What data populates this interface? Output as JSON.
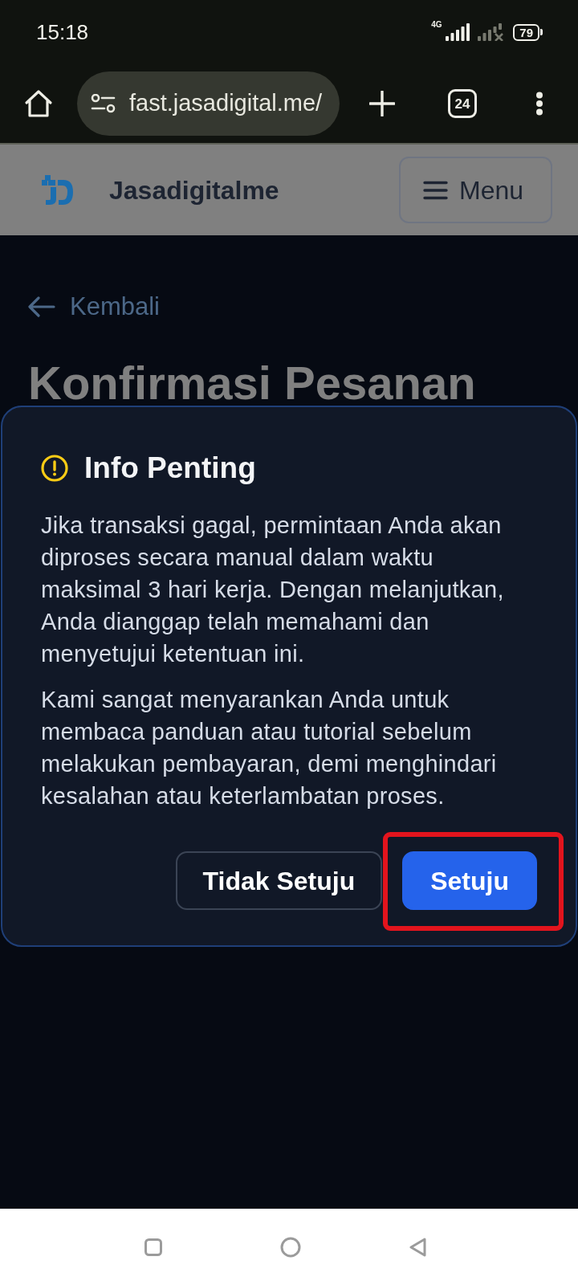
{
  "status_bar": {
    "time": "15:18",
    "network": "4G",
    "battery": "79"
  },
  "browser": {
    "url": "fast.jasadigital.me/",
    "tab_count": "24"
  },
  "navbar": {
    "brand": "Jasadigitalme",
    "menu_button": "Menu"
  },
  "page": {
    "back_link": "Kembali",
    "title": "Konfirmasi Pesanan"
  },
  "dialog": {
    "title": "Info Penting",
    "paragraphs": [
      "Jika transaksi gagal, permintaan Anda akan diproses secara manual dalam waktu maksimal 3 hari kerja. Dengan melanjutkan, Anda dianggap telah memahami dan menyetujui ketentuan ini.",
      "Kami sangat menyarankan Anda untuk membaca panduan atau tutorial sebelum melakukan pembayaran, demi menghindari kesalahan atau keterlambatan proses."
    ],
    "buttons": [
      {
        "label": "Tidak Setuju",
        "kind": "outline",
        "highlighted": false
      },
      {
        "label": "Setuju",
        "kind": "primary",
        "highlighted": true
      }
    ]
  }
}
